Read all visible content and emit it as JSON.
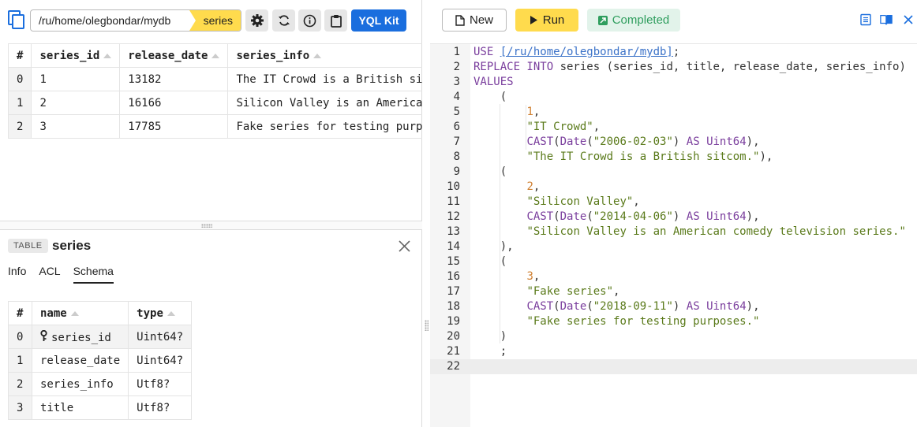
{
  "query_path": {
    "path": "/ru/home/olegbondar/mydb",
    "tag": "series"
  },
  "toolbar": {
    "yql_kit_label": "YQL Kit",
    "icons": [
      "settings-icon",
      "refresh-icon",
      "info-icon",
      "clipboard-icon"
    ]
  },
  "results": {
    "columns": [
      "#",
      "series_id",
      "release_date",
      "series_info"
    ],
    "rows": [
      [
        "0",
        "1",
        "13182",
        "The IT Crowd is a British si"
      ],
      [
        "1",
        "2",
        "16166",
        "Silicon Valley is an America"
      ],
      [
        "2",
        "3",
        "17785",
        "Fake series for testing purp"
      ]
    ]
  },
  "table_panel": {
    "badge": "TABLE",
    "title": "series",
    "tabs": [
      "Info",
      "ACL",
      "Schema"
    ],
    "active_tab": "Schema",
    "schema_columns": [
      "#",
      "name",
      "type"
    ],
    "schema_rows": [
      [
        "0",
        "series_id",
        "Uint64?"
      ],
      [
        "1",
        "release_date",
        "Uint64?"
      ],
      [
        "2",
        "series_info",
        "Utf8?"
      ],
      [
        "3",
        "title",
        "Utf8?"
      ]
    ]
  },
  "editor_toolbar": {
    "new_label": "New",
    "run_label": "Run",
    "status_label": "Completed",
    "colors": {
      "run": "#ffdb4d",
      "status_bg": "#e2f3ea",
      "status_fg": "#2f9e5e",
      "accent": "#1a6ede"
    }
  },
  "editor": {
    "lines": [
      [
        "USE ",
        "[/ru/home/olegbondar/mydb]",
        ";"
      ],
      [
        "REPLACE INTO ",
        "series (series_id, title, release_date, series_info)"
      ],
      [
        "VALUES"
      ],
      [
        "    ("
      ],
      [
        "        ",
        "1",
        ","
      ],
      [
        "        ",
        "\"IT Crowd\"",
        ","
      ],
      [
        "        ",
        "CAST",
        "(",
        "Date",
        "(",
        "\"2006-02-03\"",
        ") ",
        "AS ",
        "Uint64",
        "),"
      ],
      [
        "        ",
        "\"The IT Crowd is a British sitcom.\"",
        "),"
      ],
      [
        "    ("
      ],
      [
        "        ",
        "2",
        ","
      ],
      [
        "        ",
        "\"Silicon Valley\"",
        ","
      ],
      [
        "        ",
        "CAST",
        "(",
        "Date",
        "(",
        "\"2014-04-06\"",
        ") ",
        "AS ",
        "Uint64",
        "),"
      ],
      [
        "        ",
        "\"Silicon Valley is an American comedy television series.\""
      ],
      [
        "    ),"
      ],
      [
        "    ("
      ],
      [
        "        ",
        "3",
        ","
      ],
      [
        "        ",
        "\"Fake series\"",
        ","
      ],
      [
        "        ",
        "CAST",
        "(",
        "Date",
        "(",
        "\"2018-09-11\"",
        ") ",
        "AS ",
        "Uint64",
        "),"
      ],
      [
        "        ",
        "\"Fake series for testing purposes.\""
      ],
      [
        "    )"
      ],
      [
        "    ;"
      ],
      [
        ""
      ]
    ],
    "active_line": 22
  }
}
